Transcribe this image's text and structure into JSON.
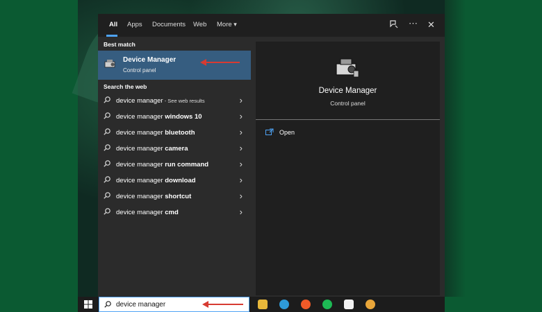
{
  "tabs": [
    "All",
    "Apps",
    "Documents",
    "Web",
    "More"
  ],
  "more_caret": "▾",
  "sections": {
    "best_match": "Best match",
    "search_web": "Search the web"
  },
  "best_match": {
    "title": "Device Manager",
    "subtitle": "Control panel"
  },
  "web_results": [
    {
      "prefix": "device manager",
      "bold": "",
      "extra": " - See web results"
    },
    {
      "prefix": "device manager ",
      "bold": "windows 10",
      "extra": ""
    },
    {
      "prefix": "device manager ",
      "bold": "bluetooth",
      "extra": ""
    },
    {
      "prefix": "device manager ",
      "bold": "camera",
      "extra": ""
    },
    {
      "prefix": "device manager ",
      "bold": "run command",
      "extra": ""
    },
    {
      "prefix": "device manager ",
      "bold": "download",
      "extra": ""
    },
    {
      "prefix": "device manager ",
      "bold": "shortcut",
      "extra": ""
    },
    {
      "prefix": "device manager ",
      "bold": "cmd",
      "extra": ""
    }
  ],
  "preview": {
    "title": "Device Manager",
    "subtitle": "Control panel",
    "open_label": "Open"
  },
  "topbar_icons": {
    "feedback": "feedback-icon",
    "more": "⋯",
    "close": "✕"
  },
  "taskbar": {
    "search_value": "device manager",
    "apps": [
      {
        "name": "file-explorer-icon",
        "color": "#e8b83a"
      },
      {
        "name": "edge-icon",
        "color": "#2e9ad8"
      },
      {
        "name": "brave-icon",
        "color": "#f05a28"
      },
      {
        "name": "spotify-icon",
        "color": "#1db954"
      },
      {
        "name": "notion-icon",
        "color": "#f2f2f2"
      },
      {
        "name": "chrome-icon",
        "color": "#e9a63a"
      }
    ]
  },
  "colors": {
    "accent": "#4ea3f5",
    "selection": "#365d80",
    "annotation_arrow": "#d73b32"
  }
}
